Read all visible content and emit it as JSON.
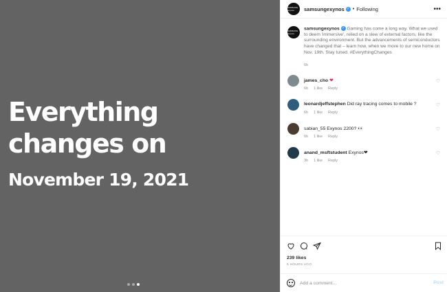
{
  "media": {
    "headline_line1": "Everything",
    "headline_line2": "changes on",
    "headline_date": "November 19, 2021",
    "carousel_dots": 3,
    "carousel_active_index": 2
  },
  "header": {
    "username": "samsungexynos",
    "separator": "•",
    "follow_label": "Following",
    "more_icon": "more-horizontal-icon",
    "avatar_text": "SAMSUNG Exynos"
  },
  "caption": {
    "username": "samsungexynos",
    "text": "Gaming has come a long way. What we used to deem 'immersive', relied on a slew of external factors, like the surrounding environment. But the advancements of semiconductors have changed that – learn how, when we move to our new home on Nov. 19th. Stay tuned. #EverythingChanges",
    "time": "6h"
  },
  "comments": [
    {
      "username": "james_cho",
      "text": "❤",
      "time": "6h",
      "likes": "1 like",
      "reply": "Reply",
      "avatar_color": "#7d8a8e"
    },
    {
      "username": "leonardjeffstephen",
      "text": "Did ray tracing comes to mobile ?",
      "time": "6h",
      "likes": "1 like",
      "reply": "Reply",
      "avatar_color": "#2f5d7c"
    },
    {
      "username": "sabian_55",
      "text": "Exynos 2200? 👀",
      "time": "6h",
      "likes": "1 like",
      "reply": "Reply",
      "avatar_color": "#4a3c2e"
    },
    {
      "username": "anand_msftstudent",
      "text": "Exynos❤",
      "time": "3h",
      "likes": "1 like",
      "reply": "Reply",
      "avatar_color": "#1f3a4a"
    }
  ],
  "actions": {
    "icons": [
      "heart-icon",
      "comment-icon",
      "share-icon",
      "bookmark-icon"
    ]
  },
  "likes_label": "239 likes",
  "time_ago": "6 HOURS AGO",
  "add_comment": {
    "placeholder": "Add a comment...",
    "post_label": "Post"
  },
  "colors": {
    "media_bg": "#636363",
    "verified": "#3897f0",
    "post_disabled": "#b2dffc"
  }
}
